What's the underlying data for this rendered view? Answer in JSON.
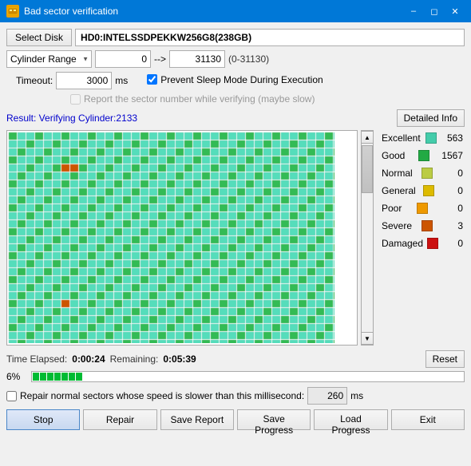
{
  "window": {
    "title": "Bad sector verification",
    "icon": "HD"
  },
  "controls": {
    "select_disk_label": "Select Disk",
    "disk_value": "HD0:INTELSSDPEKKW256G8(238GB)",
    "cylinder_range_label": "Cylinder Range",
    "range_start": "0",
    "range_arrow": "-->",
    "range_end": "31130",
    "range_info": "(0-31130)",
    "timeout_label": "Timeout:",
    "timeout_value": "3000",
    "ms_label": "ms",
    "prevent_sleep_checked": true,
    "prevent_sleep_label": "Prevent Sleep Mode During Execution",
    "report_sector_label": "Report the sector number while verifying (maybe slow)",
    "report_sector_checked": false,
    "report_sector_disabled": true
  },
  "result": {
    "text": "Result: Verifying Cylinder:2133",
    "detailed_btn": "Detailed Info"
  },
  "legend": {
    "items": [
      {
        "label": "Excellent",
        "color": "#44ccaa",
        "count": "563"
      },
      {
        "label": "Good",
        "color": "#22aa44",
        "count": "1567"
      },
      {
        "label": "Normal",
        "color": "#bbcc44",
        "count": "0"
      },
      {
        "label": "General",
        "color": "#ddbb00",
        "count": "0"
      },
      {
        "label": "Poor",
        "color": "#ee9900",
        "count": "0"
      },
      {
        "label": "Severe",
        "color": "#cc5500",
        "count": "3"
      },
      {
        "label": "Damaged",
        "color": "#cc1111",
        "count": "0"
      }
    ]
  },
  "status": {
    "time_elapsed_label": "Time Elapsed:",
    "time_elapsed": "0:00:24",
    "remaining_label": "Remaining:",
    "remaining": "0:05:39",
    "reset_btn": "Reset",
    "progress_pct": "6%",
    "progress_segments": 7
  },
  "repair": {
    "checkbox_label": "Repair normal sectors whose speed is slower than this millisecond:",
    "value": "260",
    "ms_label": "ms"
  },
  "buttons": {
    "stop": "Stop",
    "repair": "Repair",
    "save_report": "Save Report",
    "save_progress": "Save Progress",
    "load_progress": "Load Progress",
    "exit": "Exit"
  }
}
